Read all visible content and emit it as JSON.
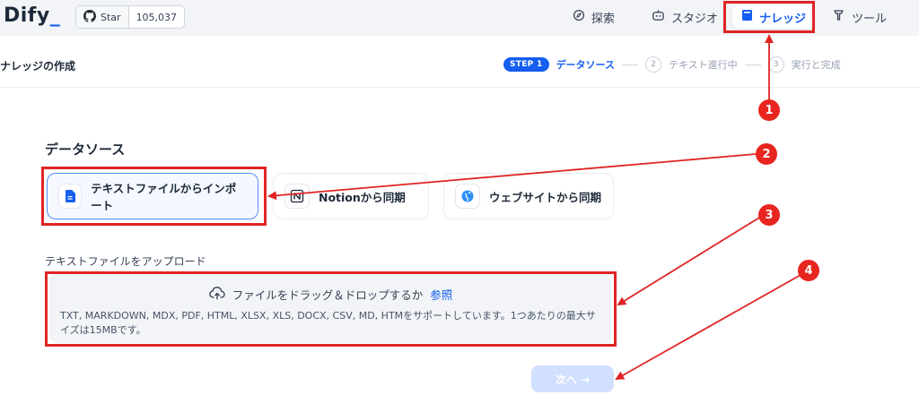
{
  "app": {
    "logo_text": "Dify",
    "logo_suffix": "_",
    "brand_color": "#155eef"
  },
  "github": {
    "star_label": "Star",
    "star_count": "105,037"
  },
  "nav": {
    "explore": "探索",
    "studio": "スタジオ",
    "knowledge": "ナレッジ",
    "tools": "ツール"
  },
  "subheader": {
    "title": "ナレッジの作成"
  },
  "stepper": {
    "step1_badge": "STEP 1",
    "step1_label": "データソース",
    "step2_num": "2",
    "step2_label": "テキスト進行中",
    "step3_num": "3",
    "step3_label": "実行と完成"
  },
  "datasource": {
    "section_title": "データソース",
    "cards": [
      {
        "label": "テキストファイルからインポート",
        "icon": "file-text-icon"
      },
      {
        "label": "Notionから同期",
        "icon": "notion-icon"
      },
      {
        "label": "ウェブサイトから同期",
        "icon": "website-icon"
      }
    ]
  },
  "upload": {
    "label": "テキストファイルをアップロード",
    "drop_text": "ファイルをドラッグ＆ドロップするか",
    "browse_text": "参照",
    "tip": "TXT, MARKDOWN, MDX, PDF, HTML, XLSX, XLS, DOCX, CSV, MD, HTMをサポートしています。1つあたりの最大サイズは15MBです。"
  },
  "next_button": "次へ →",
  "annotations": {
    "markers": [
      "1",
      "2",
      "3",
      "4"
    ],
    "color": "#e02424"
  }
}
